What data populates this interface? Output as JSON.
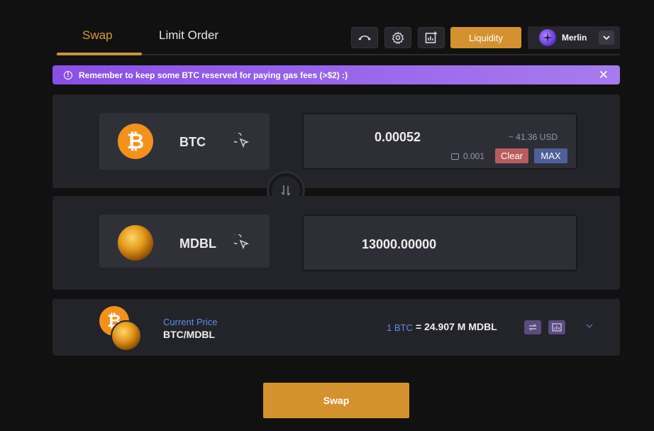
{
  "tabs": [
    {
      "label": "Swap",
      "active": true
    },
    {
      "label": "Limit Order",
      "active": false
    }
  ],
  "toolbar": {
    "icons": [
      "recent-trades-icon",
      "settings-icon",
      "add-chart-icon"
    ],
    "liquidity_label": "Liquidity",
    "wallet_name": "Merlin"
  },
  "banner": {
    "text": "Remember to keep some BTC reserved for paying gas fees (>$2) :)"
  },
  "from": {
    "symbol": "BTC",
    "amount": "0.00052",
    "usd_value": "~ 41.36 USD",
    "balance": "0.001",
    "clear_label": "Clear",
    "max_label": "MAX"
  },
  "to": {
    "symbol": "MDBL",
    "amount": "13000.00000"
  },
  "price": {
    "label": "Current Price",
    "pair": "BTC/MDBL",
    "base": "1 BTC",
    "quote": "= 24.907 M MDBL"
  },
  "swap_label": "Swap",
  "colors": {
    "accent": "#d4922e",
    "banner": "#8a4fe6",
    "clear": "#b85c60",
    "max": "#4e5f9a",
    "link": "#5d8ee8"
  }
}
